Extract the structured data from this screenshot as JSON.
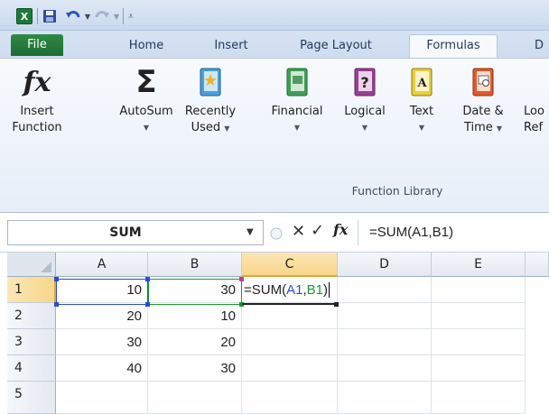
{
  "quick_access": {
    "app_logo": "X",
    "icons": [
      "excel-logo-icon",
      "save-icon",
      "undo-icon",
      "redo-icon",
      "customize-icon"
    ]
  },
  "tabs": [
    {
      "label": "File"
    },
    {
      "label": "Home"
    },
    {
      "label": "Insert"
    },
    {
      "label": "Page Layout"
    },
    {
      "label": "Formulas"
    },
    {
      "label": "D"
    }
  ],
  "ribbon": {
    "buttons": [
      {
        "icon": "insert-function-icon",
        "label1": "Insert",
        "label2": "Function"
      },
      {
        "icon": "autosum-icon",
        "label1": "AutoSum",
        "label2": ""
      },
      {
        "icon": "recently-used-icon",
        "label1": "Recently",
        "label2": "Used"
      },
      {
        "icon": "financial-icon",
        "label1": "Financial",
        "label2": ""
      },
      {
        "icon": "logical-icon",
        "label1": "Logical",
        "label2": ""
      },
      {
        "icon": "text-icon",
        "label1": "Text",
        "label2": ""
      },
      {
        "icon": "date-time-icon",
        "label1": "Date &",
        "label2": "Time"
      },
      {
        "icon": "lookup-reference-icon",
        "label1": "Loo",
        "label2": "Ref"
      }
    ],
    "group_label": "Function Library"
  },
  "formula_bar": {
    "name_box": "SUM",
    "cancel_symbol": "✕",
    "enter_symbol": "✓",
    "fx_symbol": "fx",
    "formula": "=SUM(A1,B1)"
  },
  "grid": {
    "columns": [
      "A",
      "B",
      "C",
      "D",
      "E"
    ],
    "rows": [
      "1",
      "2",
      "3",
      "4",
      "5"
    ],
    "active_column": "C",
    "active_row": "1",
    "cells": {
      "A1": "10",
      "B1": "30",
      "A2": "20",
      "B2": "10",
      "A3": "30",
      "B3": "20",
      "A4": "40",
      "B4": "30"
    },
    "editing_formula": {
      "prefix": "=SUM(",
      "ref1": "A1",
      "comma": ",",
      "ref2": "B1",
      "suffix": ")"
    },
    "ref_colors": {
      "A1": "#2b4bd6",
      "B1": "#159c2e"
    }
  }
}
